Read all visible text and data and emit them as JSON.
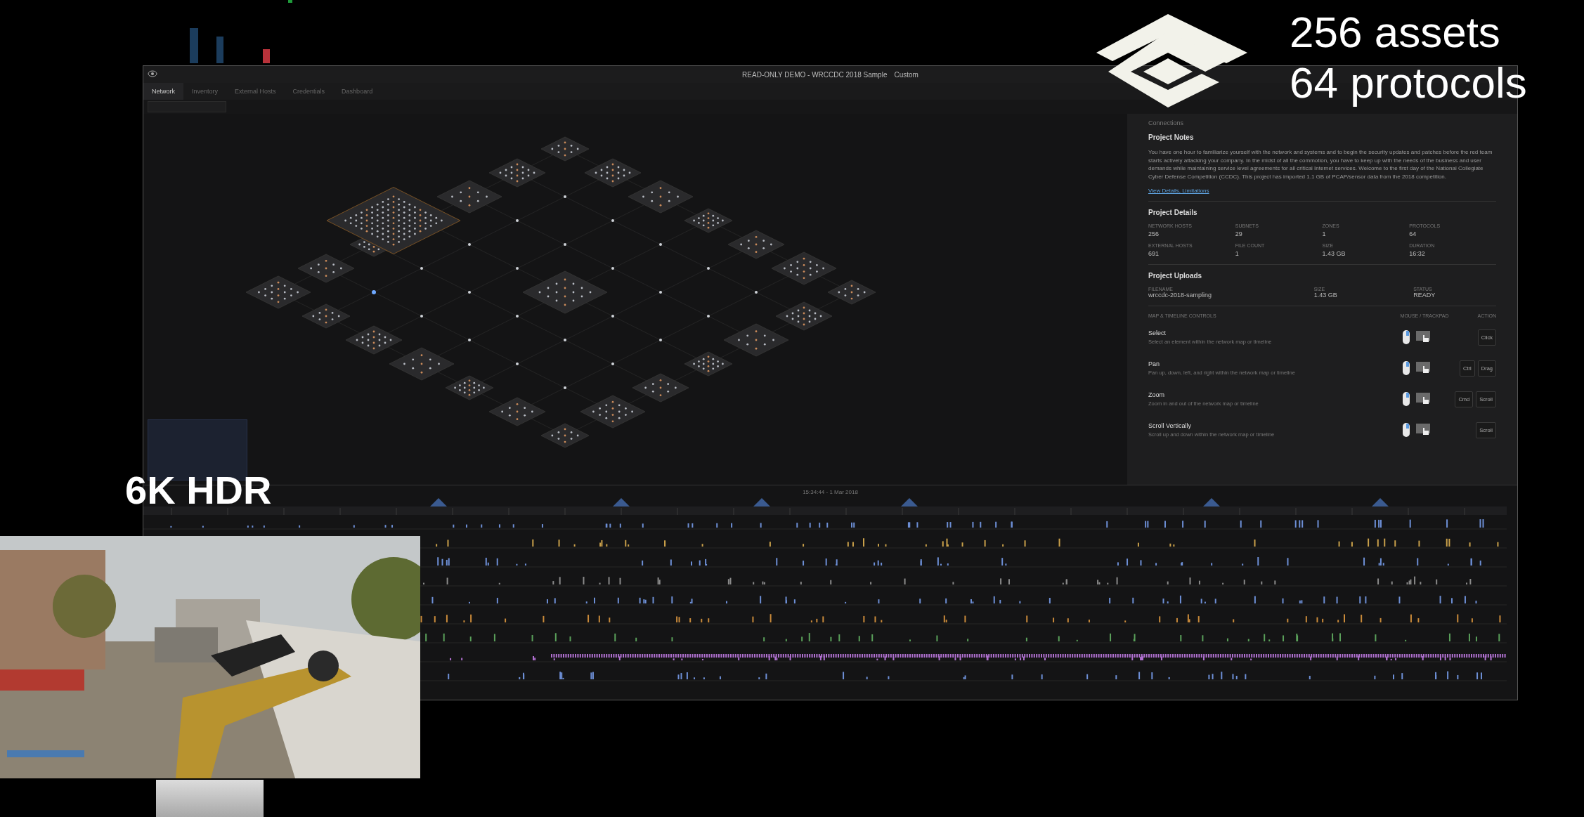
{
  "overlay": {
    "headline": [
      "256 assets",
      "64 protocols"
    ],
    "badge": "6K HDR"
  },
  "window": {
    "title": "READ-ONLY DEMO - WRCCDC 2018 Sample",
    "view": "Custom"
  },
  "tabs": [
    {
      "label": "Network",
      "selected": true
    },
    {
      "label": "Inventory",
      "selected": false
    },
    {
      "label": "External Hosts",
      "selected": false
    },
    {
      "label": "Credentials",
      "selected": false
    },
    {
      "label": "Dashboard",
      "selected": false
    }
  ],
  "panel": {
    "tab": "Connections",
    "notes": {
      "heading": "Project Notes",
      "text": "You have one hour to familiarize yourself with the network and systems and to begin the security updates and patches before the red team starts actively attacking your company. In the midst of all the commotion, you have to keep up with the needs of the business and user demands while maintaining service level agreements for all critical Internet services. Welcome to the first day of the National Collegiate Cyber Defense Competition (CCDC). This project has imported 1.1 GB of PCAP/sensor data from the 2018 competition.",
      "link": "View Details, Limitations"
    },
    "details": {
      "heading": "Project Details",
      "stats": [
        {
          "label": "NETWORK HOSTS",
          "value": "256"
        },
        {
          "label": "SUBNETS",
          "value": "29"
        },
        {
          "label": "ZONES",
          "value": "1"
        },
        {
          "label": "PROTOCOLS",
          "value": "64"
        },
        {
          "label": "EXTERNAL HOSTS",
          "value": "691"
        },
        {
          "label": "FILE COUNT",
          "value": "1"
        },
        {
          "label": "SIZE",
          "value": "1.43 GB"
        },
        {
          "label": "DURATION",
          "value": "16:32"
        }
      ]
    },
    "uploads": {
      "heading": "Project Uploads",
      "columns": [
        "FILENAME",
        "SIZE",
        "STATUS"
      ],
      "row": [
        "wrccdc-2018-sampling",
        "1.43 GB",
        "READY"
      ]
    },
    "controls": {
      "columns": [
        "MAP & TIMELINE CONTROLS",
        "MOUSE / TRACKPAD",
        "ACTION"
      ],
      "rows": [
        {
          "name": "Select",
          "description": "Select an element within the network map or timeline",
          "keys": [
            "Click"
          ]
        },
        {
          "name": "Pan",
          "description": "Pan up, down, left, and right within the network map or timeline",
          "keys": [
            "Ctrl",
            "Drag"
          ]
        },
        {
          "name": "Zoom",
          "description": "Zoom in and out of the network map or timeline",
          "keys": [
            "Cmd",
            "Scroll"
          ]
        },
        {
          "name": "Scroll Vertically",
          "description": "Scroll up and down within the network map or timeline",
          "keys": [
            "Scroll"
          ]
        }
      ]
    }
  },
  "timeline": {
    "date": "15:34:44 - 1 Mar 2018"
  }
}
